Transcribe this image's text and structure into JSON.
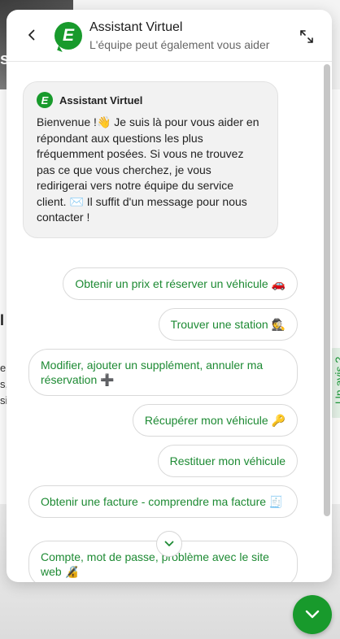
{
  "header": {
    "title": "Assistant Virtuel",
    "subtitle": "L'équipe peut également vous aider",
    "logo_letter": "E"
  },
  "message": {
    "sender": "Assistant Virtuel",
    "text": "Bienvenue !👋 Je suis là pour vous aider en répondant aux questions les plus fréquemment posées. Si vous ne trouvez pas ce que vous cherchez, je vous redirigerai vers notre équipe du service client. ✉️ Il suffit d'un message pour nous contacter !"
  },
  "choices": [
    "Obtenir un prix et réserver un véhicule 🚗",
    "Trouver une station 🕵️",
    "Modifier, ajouter un supplément, annuler ma réservation ➕",
    "Récupérer mon véhicule 🔑",
    "Restituer mon véhicule",
    "Obtenir une facture - comprendre ma facture 🧾",
    "Compte, mot de passe, problème avec le site web 🔏"
  ],
  "feedback_tab": "Un avis ?",
  "colors": {
    "brand": "#189a2c",
    "choice_text": "#1d8a33"
  },
  "icons": [
    "back-arrow-icon",
    "expand-icon",
    "chevron-down-icon"
  ]
}
